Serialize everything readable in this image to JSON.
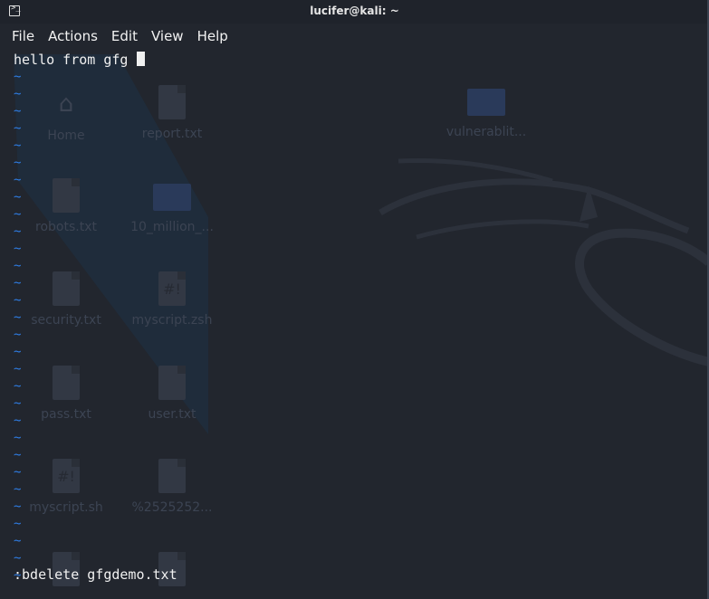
{
  "window": {
    "title": "lucifer@kali: ~"
  },
  "menu": [
    "File",
    "Actions",
    "Edit",
    "View",
    "Help"
  ],
  "editor": {
    "buffer_line": "hello from gfg ",
    "tilde": "~",
    "tilde_count": 30,
    "command_line": ":bdelete gfgdemo.txt"
  },
  "desktop": {
    "icons": [
      {
        "label": "Home",
        "kind": "home"
      },
      {
        "label": "report.txt",
        "kind": "doc"
      },
      {
        "label": "vulnerablit...",
        "kind": "folder"
      },
      {
        "label": "robots.txt",
        "kind": "doc"
      },
      {
        "label": "10_million_...",
        "kind": "folder"
      },
      {
        "label": "security.txt",
        "kind": "doc"
      },
      {
        "label": "myscript.zsh",
        "kind": "script"
      },
      {
        "label": "pass.txt",
        "kind": "doc"
      },
      {
        "label": "user.txt",
        "kind": "doc"
      },
      {
        "label": "myscript.sh",
        "kind": "script"
      },
      {
        "label": "%2525252...",
        "kind": "doc"
      }
    ]
  },
  "colors": {
    "background": "#22262e",
    "titlebar": "#1f232b",
    "text": "#f0f0f0",
    "tilde": "#2f7ee6",
    "faded_icon": "#3c4453"
  }
}
